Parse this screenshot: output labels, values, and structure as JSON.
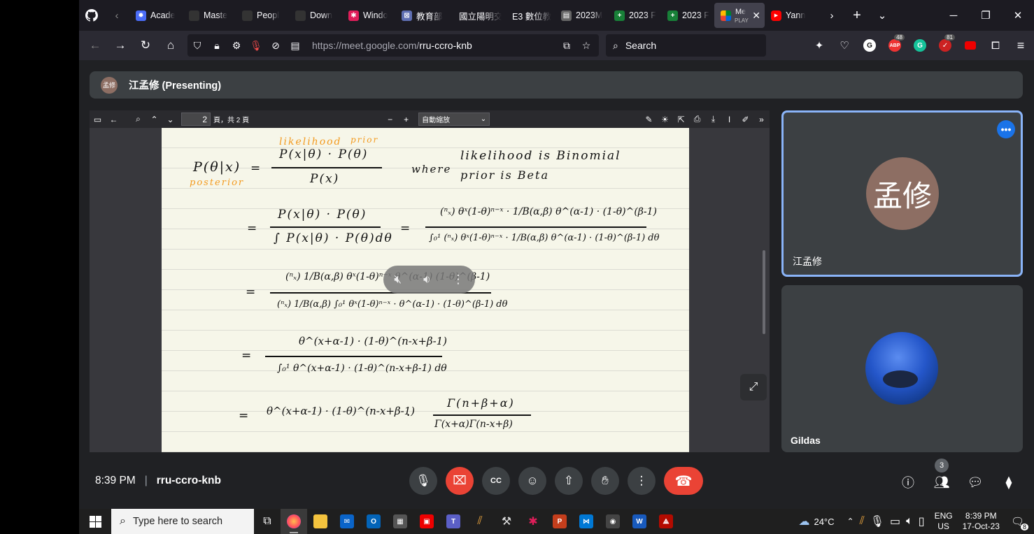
{
  "browser": {
    "tabs": [
      {
        "label": "Acade",
        "color": "#4a6cf7",
        "glyph": "✹"
      },
      {
        "label": "Maste",
        "color": "#333",
        "glyph": ""
      },
      {
        "label": "Peopl",
        "color": "#333",
        "glyph": ""
      },
      {
        "label": "Down",
        "color": "#333",
        "glyph": ""
      },
      {
        "label": "Windo",
        "color": "#e01e5a",
        "glyph": "✱"
      },
      {
        "label": "教育部",
        "color": "#5f6fb3",
        "glyph": "⊠"
      },
      {
        "label": "國立陽明交",
        "color": "",
        "glyph": ""
      },
      {
        "label": "E3 數位教",
        "color": "",
        "glyph": ""
      },
      {
        "label": "2023M",
        "color": "#666",
        "glyph": "▤"
      },
      {
        "label": "2023 F",
        "color": "#188038",
        "glyph": "+"
      },
      {
        "label": "2023 F",
        "color": "#188038",
        "glyph": "+"
      }
    ],
    "active_tab": {
      "label": "Me",
      "sub": "PLAY"
    },
    "after_tab": {
      "label": "Yann",
      "color": "#ff0000"
    },
    "url_host": "https://meet.google.com/",
    "url_path": "rru-ccro-knb",
    "search_placeholder": "Search",
    "ext_badges": {
      "abp": "48",
      "todo": "81"
    }
  },
  "meet": {
    "presenter_initials": "孟修",
    "presenter_label": "江孟修 (Presenting)",
    "pdf": {
      "page_number": "2",
      "page_total": "頁，共 2 頁",
      "zoom": "自動縮放"
    },
    "math": {
      "likelihood_note": "likelihood",
      "prior_note": "prior",
      "posterior_note": "posterior",
      "lhs": "P(θ|x)",
      "eq": "=",
      "l1_num": "P(x|θ) · P(θ)",
      "l1_den": "P(x)",
      "where": "where",
      "where_l1": "likelihood   is   Binomial",
      "where_l2": "prior        is   Beta",
      "l2_num": "P(x|θ) · P(θ)",
      "l2_den": "∫ P(x|θ) · P(θ)dθ",
      "l2r_num": "(ⁿₓ) θˣ(1-θ)ⁿ⁻ˣ · 1/B(α,β) θ^(α-1) · (1-θ)^(β-1)",
      "l2r_den": "∫₀¹ (ⁿₓ) θˣ(1-θ)ⁿ⁻ˣ · 1/B(α,β) θ^(α-1) · (1-θ)^(β-1) dθ",
      "l3_num": "(ⁿₓ) 1/B(α,β)  θˣ(1-θ)ⁿ⁻ˣ θ^(α-1) (1-θ)^(β-1)",
      "l3_den": "(ⁿₓ) 1/B(α,β) ∫₀¹ θˣ(1-θ)ⁿ⁻ˣ · θ^(α-1) · (1-θ)^(β-1) dθ",
      "l4_num": "θ^(x+α-1) · (1-θ)^(n-x+β-1)",
      "l4_den": "∫₀¹ θ^(x+α-1) · (1-θ)^(n-x+β-1) dθ",
      "l5_a": "θ^(x+α-1) · (1-θ)^(n-x+β-1)",
      "l5_dot": "·",
      "l5_num": "Γ(n+β+α)",
      "l5_den": "Γ(x+α)Γ(n-x+β)"
    },
    "tiles": [
      {
        "initials": "孟修",
        "name": "江孟修"
      },
      {
        "name": "Gildas"
      }
    ],
    "time": "8:39 PM",
    "meeting_code": "rru-ccro-knb",
    "participants_count": "3"
  },
  "taskbar": {
    "search_placeholder": "Type here to search",
    "weather": "24°C",
    "lang": "ENG",
    "region": "US",
    "clock_time": "8:39 PM",
    "clock_date": "17-Oct-23",
    "notif_count": "8"
  }
}
